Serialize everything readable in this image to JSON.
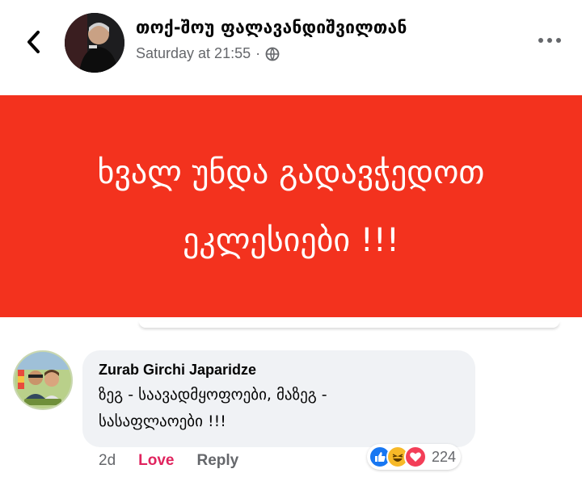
{
  "header": {
    "page_name": "თოქ-შოუ ფალავანდიშვილთან",
    "timestamp": "Saturday at 21:55",
    "separator": "·",
    "audience_icon": "globe-icon",
    "back_icon": "chevron-left-icon",
    "more_icon": "more-horizontal-icon"
  },
  "post": {
    "background": "#f3321e",
    "line1": "ხვალ უნდა გადავჭედოთ",
    "line2": "ეკლესიები !!!"
  },
  "comment": {
    "author": "Zurab Girchi Japaridze",
    "line1": "ზეგ - საავადმყოფოები, მაზეგ -",
    "line2": "სასაფლაოები !!!",
    "time": "2d",
    "love_label": "Love",
    "reply_label": "Reply",
    "reactions": [
      "like-icon",
      "haha-icon",
      "love-icon"
    ],
    "reaction_count": "224"
  },
  "colors": {
    "love": "#e0245e",
    "secondary_text": "#65676b",
    "bubble": "#f0f2f5"
  }
}
